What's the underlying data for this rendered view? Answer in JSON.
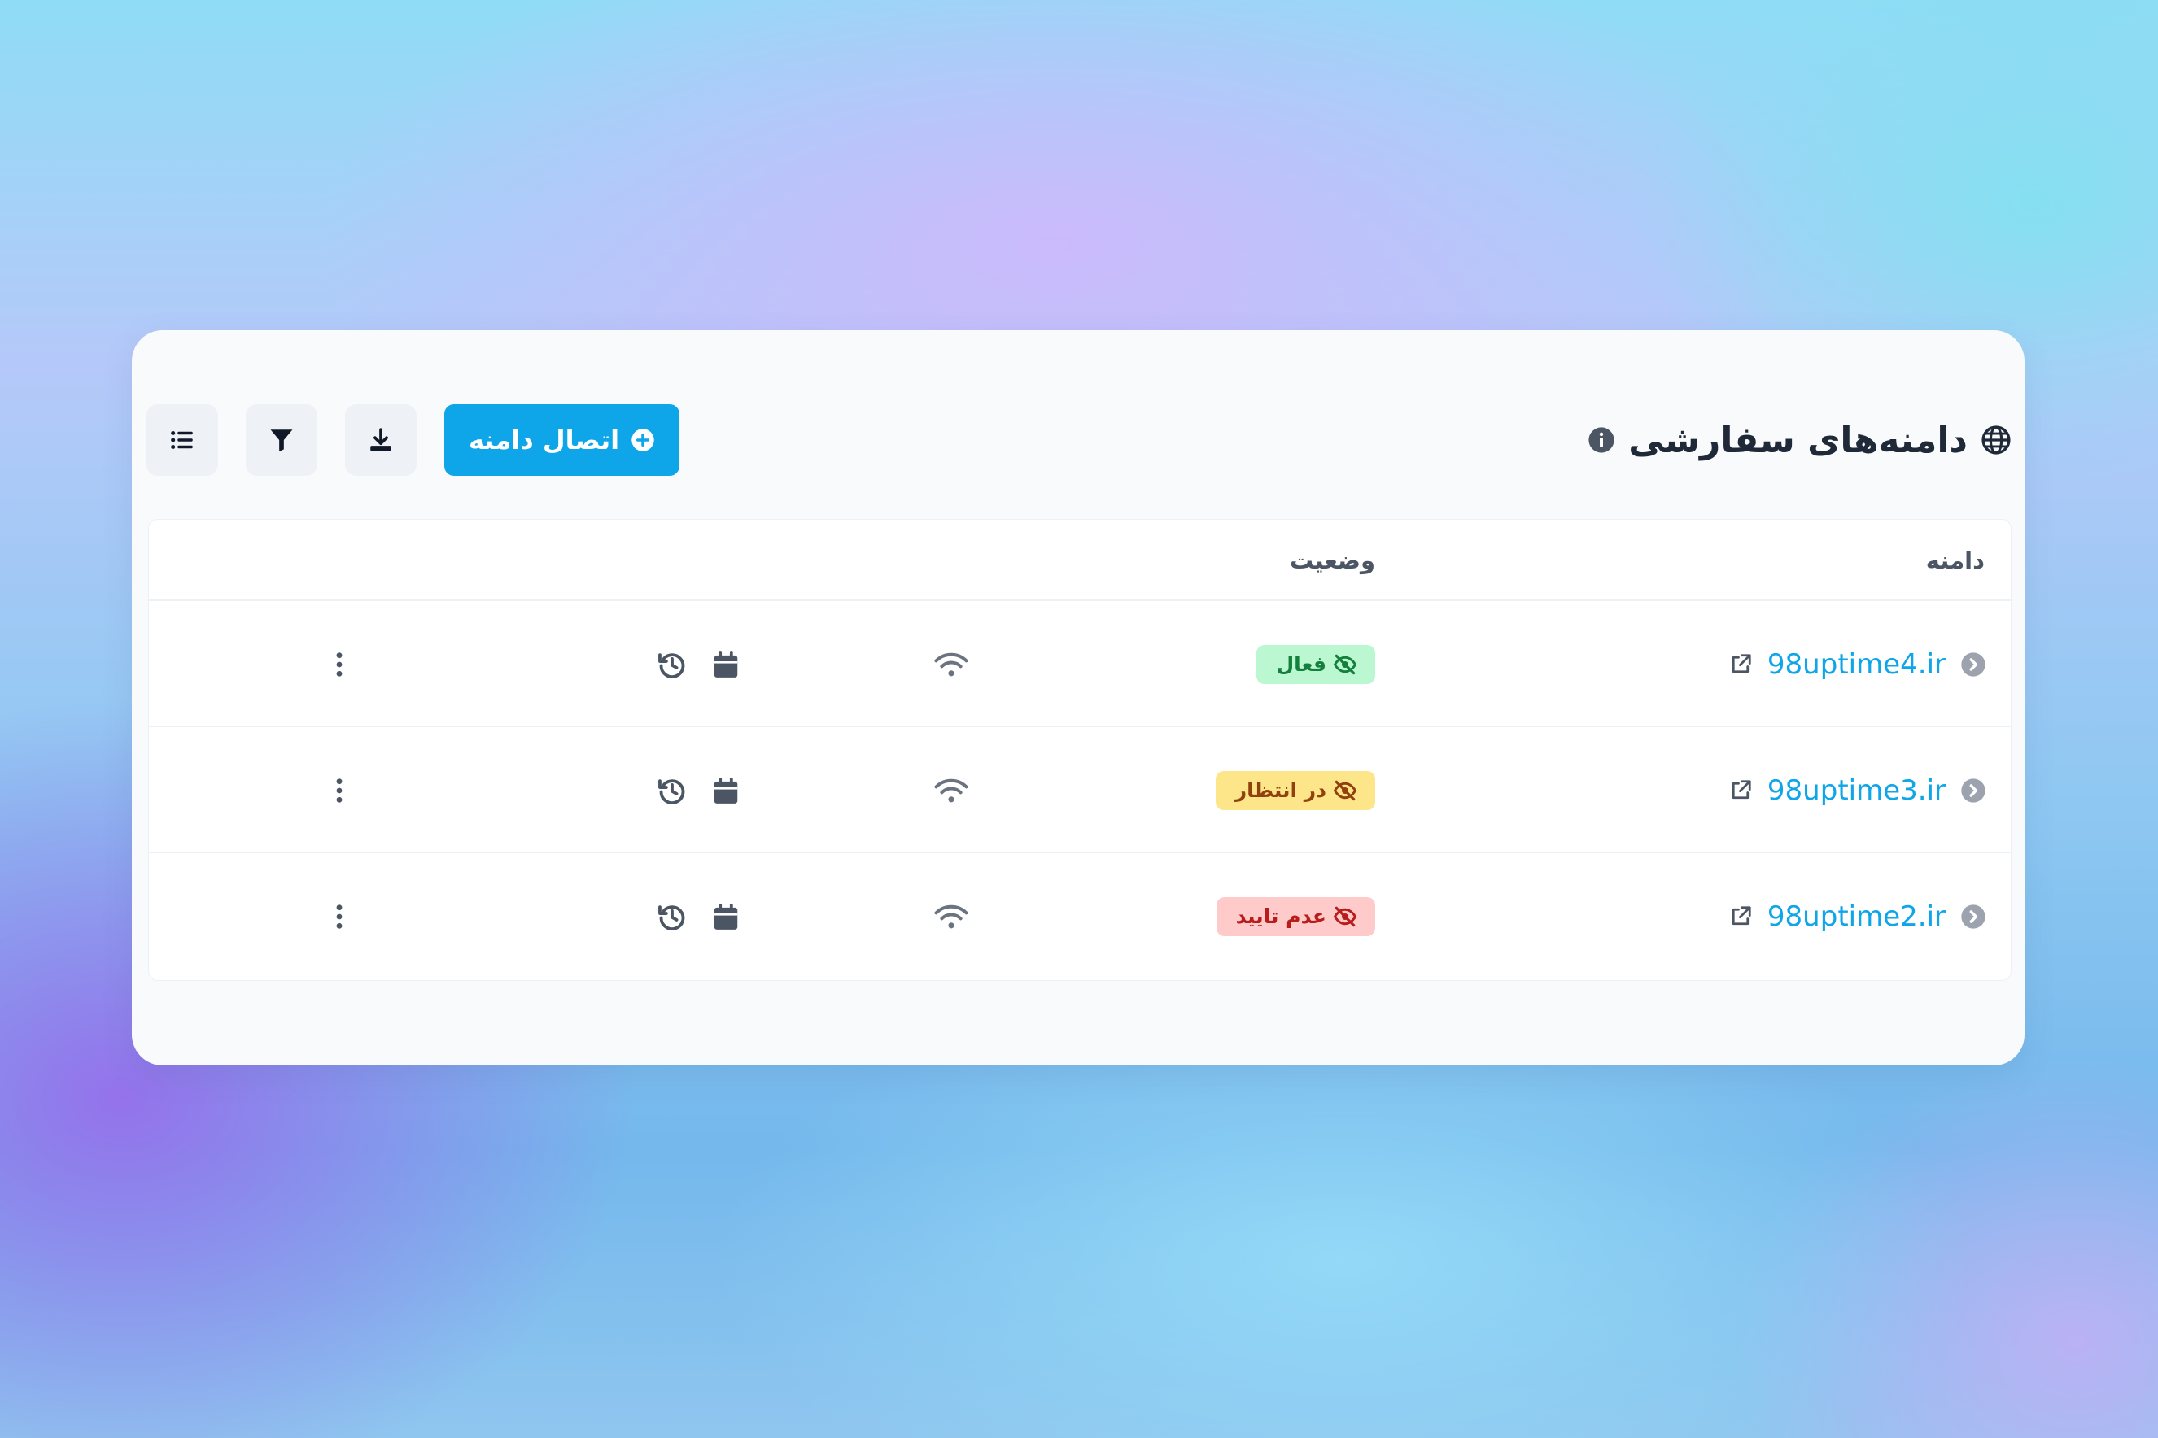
{
  "header": {
    "title": "دامنه‌های سفارشی",
    "connect_label": "اتصال دامنه",
    "icons": [
      "globe-icon",
      "info-icon",
      "plus-circle-icon",
      "download-icon",
      "filter-icon",
      "list-icon"
    ]
  },
  "table": {
    "columns": {
      "domain": "دامنه",
      "status": "وضعیت"
    },
    "rows": [
      {
        "domain": "98uptime4.ir",
        "status": "فعال",
        "status_key": "ok"
      },
      {
        "domain": "98uptime3.ir",
        "status": "در انتظار",
        "status_key": "pending"
      },
      {
        "domain": "98uptime2.ir",
        "status": "عدم تایید",
        "status_key": "rejected"
      }
    ],
    "row_icons": [
      "chevron-left-circle-icon",
      "external-link-icon",
      "eye-slash-icon",
      "wifi-icon",
      "calendar-icon",
      "history-icon",
      "more-vertical-icon"
    ]
  },
  "colors": {
    "accent": "#0ea5e9",
    "ok_bg": "#bbf7d0",
    "ok_text": "#15803d",
    "pending_bg": "#fde68a",
    "pending_text": "#92400e",
    "rejected_bg": "#fecaca",
    "rejected_text": "#b91c1c"
  }
}
